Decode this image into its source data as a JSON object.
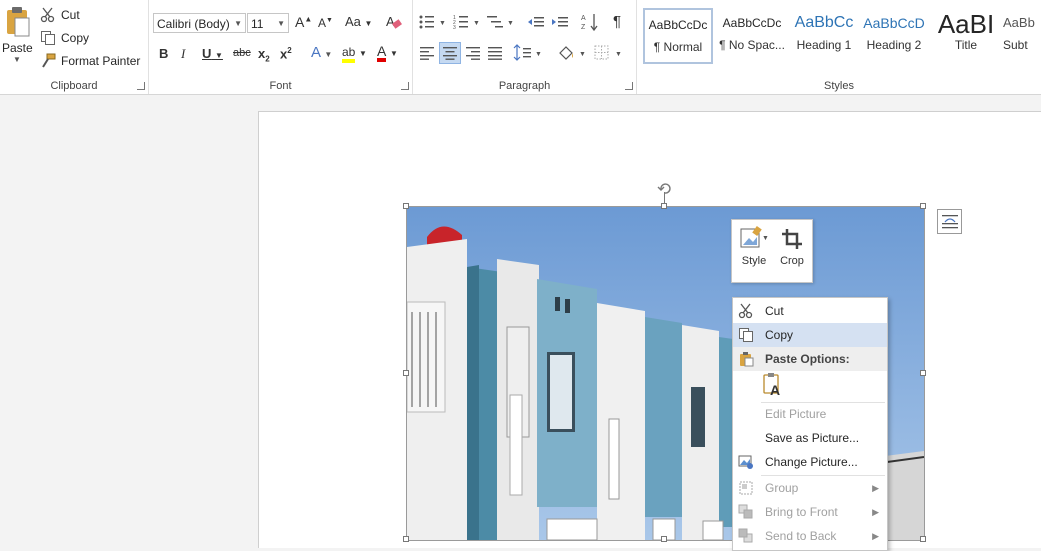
{
  "clipboard": {
    "paste_label": "Paste",
    "cut_label": "Cut",
    "copy_label": "Copy",
    "format_painter_label": "Format Painter",
    "group_label": "Clipboard"
  },
  "font": {
    "font_name": "Calibri (Body)",
    "font_size": "11",
    "group_label": "Font",
    "grow_label": "A",
    "shrink_label": "A",
    "case_label": "Aa",
    "bold_label": "B",
    "italic_label": "I",
    "underline_label": "U",
    "strike_label": "abc",
    "subscript_label": "x",
    "superscript_label": "x",
    "effects_label": "A",
    "highlight_label": "ab",
    "font_color_label": "A",
    "highlight_color": "#ffff00",
    "font_color": "#e00000"
  },
  "paragraph": {
    "group_label": "Paragraph"
  },
  "styles": {
    "group_label": "Styles",
    "items": [
      {
        "preview": "AaBbCcDc",
        "name": "¶ Normal"
      },
      {
        "preview": "AaBbCcDc",
        "name": "¶ No Spac..."
      },
      {
        "preview": "AaBbCc",
        "name": "Heading 1"
      },
      {
        "preview": "AaBbCcD",
        "name": "Heading 2"
      },
      {
        "preview": "AaBI",
        "name": "Title"
      },
      {
        "preview": "AaBb",
        "name": "Subt"
      }
    ],
    "heading_color": "#2e74b5"
  },
  "mini_toolbar": {
    "style_label": "Style",
    "crop_label": "Crop"
  },
  "context_menu": {
    "cut": "Cut",
    "copy": "Copy",
    "paste_options": "Paste Options:",
    "edit_picture": "Edit Picture",
    "save_as_picture": "Save as Picture...",
    "change_picture": "Change Picture...",
    "group": "Group",
    "bring_to_front": "Bring to Front",
    "send_to_back": "Send to Back"
  }
}
